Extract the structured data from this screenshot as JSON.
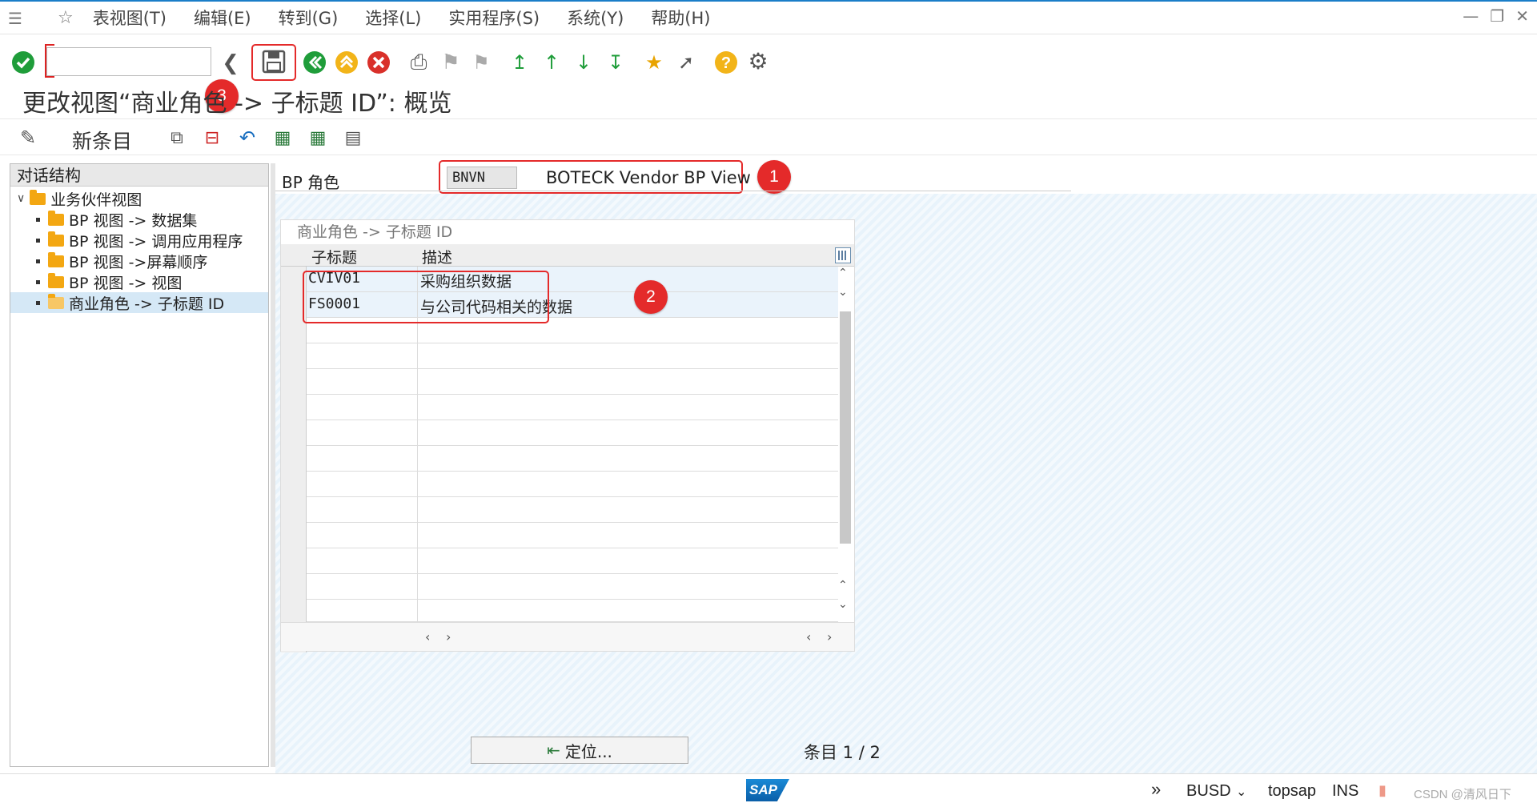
{
  "menu": [
    "表视图(T)",
    "编辑(E)",
    "转到(G)",
    "选择(L)",
    "实用程序(S)",
    "系统(Y)",
    "帮助(H)"
  ],
  "toolbar": {
    "command_value": ""
  },
  "badges": {
    "b1": "1",
    "b2": "2",
    "b3": "3"
  },
  "title": "更改视图“商业角色 -> 子标题 ID”: 概览",
  "apptoolbar": {
    "new_entry": "新条目"
  },
  "left_panel": {
    "header": "对话结构",
    "root": "业务伙伴视图",
    "items": [
      "BP 视图 -> 数据集",
      "BP 视图 -> 调用应用程序",
      "BP 视图 ->屏幕顺序",
      "BP 视图 -> 视图",
      "商业角色 -> 子标题 ID"
    ]
  },
  "bp_role": {
    "label": "BP 角色",
    "code": "BNVN",
    "description": "BOTECK Vendor BP View"
  },
  "table": {
    "title": "商业角色 -> 子标题 ID",
    "col1": "子标题",
    "col2": "描述",
    "rows": [
      {
        "sub": "CVIV01",
        "desc": "采购组织数据"
      },
      {
        "sub": "FS0001",
        "desc": "与公司代码相关的数据"
      }
    ]
  },
  "locate_button": "定位...",
  "entries": "条目 1 / 2",
  "status": {
    "sap": "SAP",
    "client": "BUSD",
    "host": "topsap",
    "mode": "INS",
    "watermark": "CSDN @清风日下"
  },
  "colors": {
    "accent": "#1a7ec8",
    "annotation_red": "#e42a2a",
    "folder": "#f3a712"
  }
}
